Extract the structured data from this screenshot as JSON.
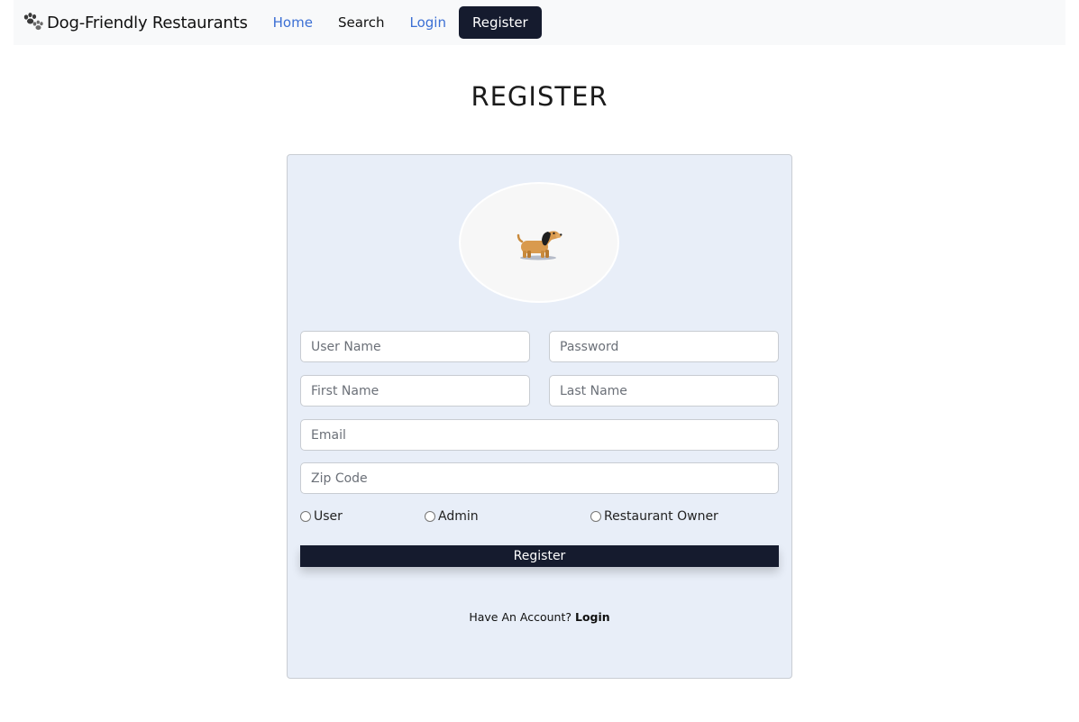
{
  "nav": {
    "brand": "Dog-Friendly Restaurants",
    "links": [
      {
        "label": "Home"
      },
      {
        "label": "Search"
      },
      {
        "label": "Login"
      },
      {
        "label": "Register"
      }
    ]
  },
  "page": {
    "title": "REGISTER"
  },
  "form": {
    "avatar_icon": "dachshund-dog-icon",
    "fields": {
      "username": {
        "placeholder": "User Name",
        "value": ""
      },
      "password": {
        "placeholder": "Password",
        "value": ""
      },
      "first_name": {
        "placeholder": "First Name",
        "value": ""
      },
      "last_name": {
        "placeholder": "Last Name",
        "value": ""
      },
      "email": {
        "placeholder": "Email",
        "value": ""
      },
      "zip": {
        "placeholder": "Zip Code",
        "value": ""
      }
    },
    "roles": [
      {
        "label": "User",
        "checked": false
      },
      {
        "label": "Admin",
        "checked": false
      },
      {
        "label": "Restaurant Owner",
        "checked": false
      }
    ],
    "submit_label": "Register",
    "account_prompt": "Have An Account?",
    "login_label": "Login"
  },
  "colors": {
    "accent_dark": "#151b2e",
    "link_blue": "#3b6fd4",
    "card_bg": "#e8eef8",
    "navbar_bg": "#f8f9fa"
  }
}
